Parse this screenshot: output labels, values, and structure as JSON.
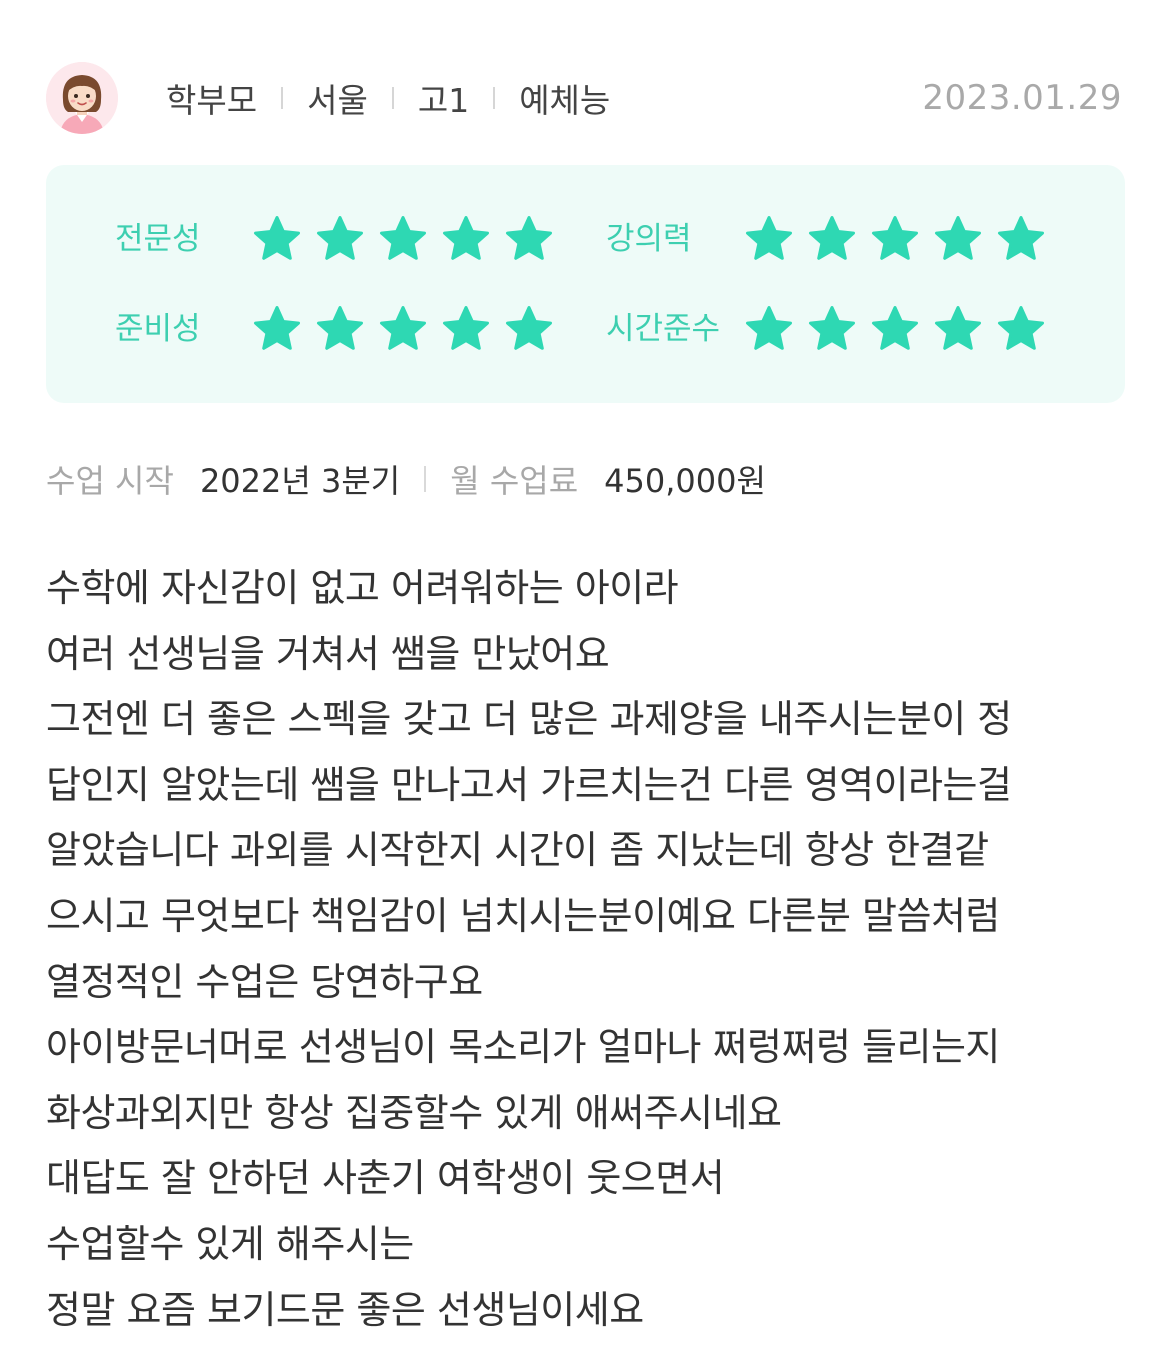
{
  "header": {
    "avatar_icon": "parent-avatar-icon",
    "role": "학부모",
    "region": "서울",
    "grade": "고1",
    "subject": "예체능",
    "date": "2023.01.29"
  },
  "ratings": {
    "star_color": "#2ed8b3",
    "items": [
      {
        "label": "전문성",
        "score": 5,
        "max": 5
      },
      {
        "label": "강의력",
        "score": 5,
        "max": 5
      },
      {
        "label": "준비성",
        "score": 5,
        "max": 5
      },
      {
        "label": "시간준수",
        "score": 5,
        "max": 5
      }
    ]
  },
  "lesson": {
    "start_label": "수업 시작",
    "start_value": "2022년 3분기",
    "fee_label": "월 수업료",
    "fee_value": "450,000원"
  },
  "review": {
    "lines": [
      "수학에 자신감이 없고 어려워하는 아이라",
      "여러 선생님을 거쳐서 쌤을 만났어요",
      "그전엔 더 좋은 스펙을 갖고 더 많은 과제양을 내주시는분이 정",
      "답인지 알았는데 쌤을 만나고서 가르치는건 다른 영역이라는걸",
      "알았습니다 과외를 시작한지 시간이 좀 지났는데 항상 한결같",
      "으시고 무엇보다 책임감이 넘치시는분이예요 다른분 말씀처럼",
      "열정적인 수업은 당연하구요",
      "아이방문너머로 선생님이 목소리가 얼마나 쩌렁쩌렁 들리는지",
      "화상과외지만 항상 집중할수 있게 애써주시네요",
      "대답도 잘 안하던 사춘기 여학생이 웃으면서",
      "수업할수 있게 해주시는",
      "정말 요즘 보기드문 좋은 선생님이세요"
    ]
  }
}
